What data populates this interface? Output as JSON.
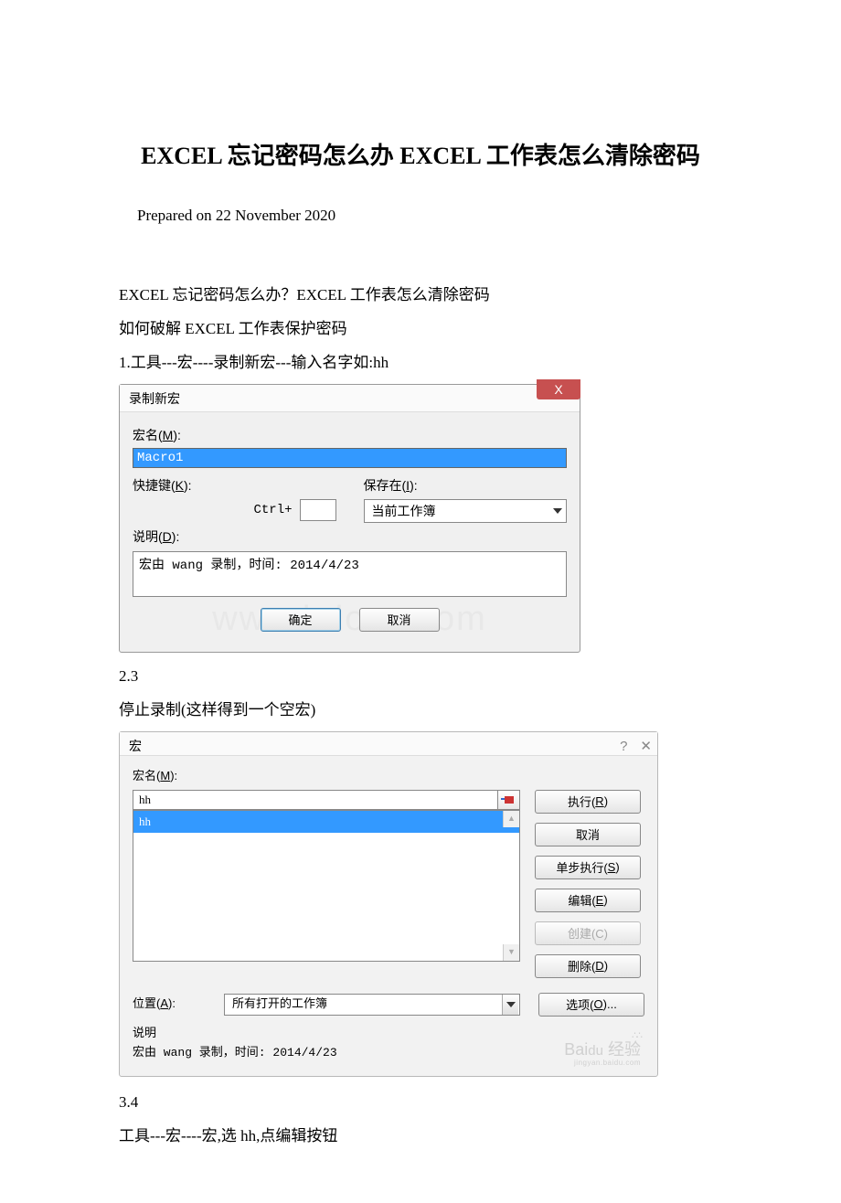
{
  "title": "EXCEL 忘记密码怎么办 EXCEL 工作表怎么清除密码",
  "prepared": "Prepared on 22 November 2020",
  "p1": "EXCEL 忘记密码怎么办？EXCEL 工作表怎么清除密码",
  "p2": "如何破解 EXCEL 工作表保护密码",
  "p3": "1.工具---宏----录制新宏---输入名字如:hh",
  "dlg1": {
    "title": "录制新宏",
    "close": "X",
    "macroName_lbl_pre": "宏名(",
    "macroName_lbl_u": "M",
    "macroName_lbl_post": "):",
    "macroName_val": "Macro1",
    "shortcut_lbl_pre": "快捷键(",
    "shortcut_lbl_u": "K",
    "shortcut_lbl_post": "):",
    "ctrl": "Ctrl+",
    "savein_lbl_pre": "保存在(",
    "savein_lbl_u": "I",
    "savein_lbl_post": "):",
    "savein_val": "当前工作簿",
    "desc_lbl_pre": "说明(",
    "desc_lbl_u": "D",
    "desc_lbl_post": "):",
    "desc_val": "宏由 wang 录制，时间: 2014/4/23",
    "ok": "确定",
    "cancel": "取消",
    "watermark": "www.bdocx.com"
  },
  "p4": "2.3",
  "p5": "停止录制(这样得到一个空宏)",
  "dlg2": {
    "title": "宏",
    "help_icon": "?",
    "close_icon": "✕",
    "macroName_lbl_pre": "宏名(",
    "macroName_lbl_u": "M",
    "macroName_lbl_post": "):",
    "name_val": "hh",
    "list_sel": "hh",
    "run": "执行(R)",
    "cancel": "取消",
    "step": "单步执行(S)",
    "edit": "编辑(E)",
    "create": "创建(C)",
    "del": "删除(D)",
    "options": "选项(O)...",
    "loc_lbl_pre": "位置(",
    "loc_lbl_u": "A",
    "loc_lbl_post": "):",
    "loc_val": "所有打开的工作簿",
    "desc_lbl": "说明",
    "desc_val": "宏由 wang 录制，时间: 2014/4/23",
    "baidu": "Baidu 经验"
  },
  "p6": "3.4",
  "p7": "工具---宏----宏,选 hh,点编辑按钮"
}
